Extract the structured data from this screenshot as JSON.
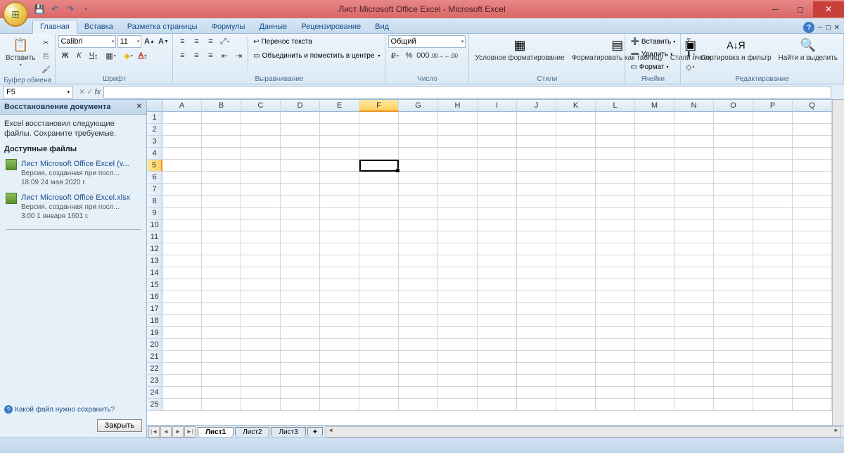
{
  "titlebar": {
    "title": "Лист Microsoft Office Excel - Microsoft Excel"
  },
  "qat": {
    "save": "💾",
    "undo": "↶",
    "redo": "↷"
  },
  "tabs": {
    "items": [
      "Главная",
      "Вставка",
      "Разметка страницы",
      "Формулы",
      "Данные",
      "Рецензирование",
      "Вид"
    ],
    "active": 0
  },
  "ribbon": {
    "clipboard": {
      "label": "Буфер обмена",
      "paste": "Вставить"
    },
    "font": {
      "label": "Шрифт",
      "name": "Calibri",
      "size": "11",
      "bold": "Ж",
      "italic": "К",
      "underline": "Ч"
    },
    "alignment": {
      "label": "Выравнивание",
      "wrap": "Перенос текста",
      "merge": "Объединить и поместить в центре"
    },
    "number": {
      "label": "Число",
      "format": "Общий"
    },
    "styles": {
      "label": "Стили",
      "conditional": "Условное форматирование",
      "table": "Форматировать как таблицу",
      "cell": "Стили ячеек"
    },
    "cells": {
      "label": "Ячейки",
      "insert": "Вставить",
      "delete": "Удалить",
      "format": "Формат"
    },
    "editing": {
      "label": "Редактирование",
      "sort": "Сортировка и фильтр",
      "find": "Найти и выделить"
    }
  },
  "namebox": {
    "value": "F5"
  },
  "recovery": {
    "title": "Восстановление документа",
    "message": "Excel восстановил следующие файлы. Сохраните требуемые.",
    "available": "Доступные файлы",
    "files": [
      {
        "name": "Лист Microsoft Office Excel (v...",
        "meta1": "Версия, созданная при посл...",
        "meta2": "18:09 24 мая 2020 г."
      },
      {
        "name": "Лист Microsoft Office Excel.xlsx",
        "meta1": "Версия, созданная при посл...",
        "meta2": "3:00 1 января 1601 г."
      }
    ],
    "help": "Какой файл нужно сохранить?",
    "close_btn": "Закрыть"
  },
  "grid": {
    "columns": [
      "A",
      "B",
      "C",
      "D",
      "E",
      "F",
      "G",
      "H",
      "I",
      "J",
      "K",
      "L",
      "M",
      "N",
      "O",
      "P",
      "Q"
    ],
    "rows": 25,
    "selected_col": "F",
    "selected_row": 5
  },
  "sheets": {
    "items": [
      "Лист1",
      "Лист2",
      "Лист3"
    ],
    "active": 0
  }
}
